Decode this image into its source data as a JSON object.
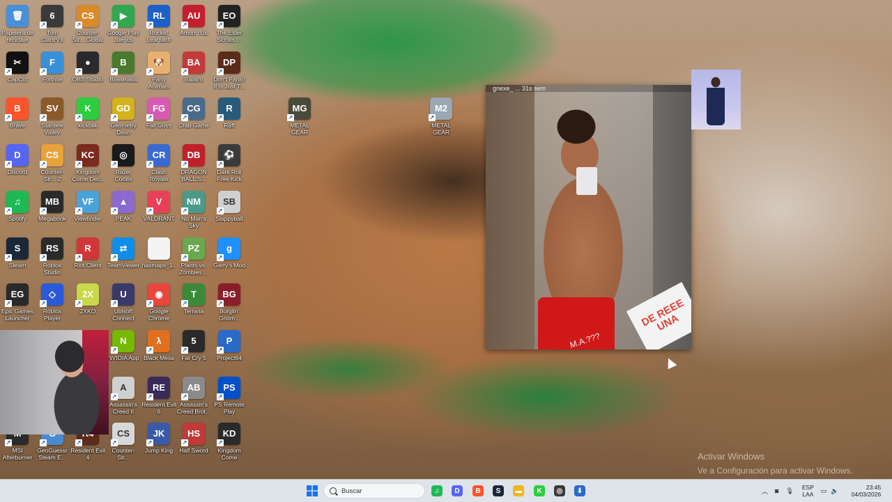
{
  "desktop": {
    "icons": [
      {
        "label": "Papelera de reciclaje",
        "glyph": "🗑",
        "color": "#4a90d9",
        "shortcut": false
      },
      {
        "label": "Tom Clancy's Rainbow Si...",
        "glyph": "6",
        "color": "#3a3a3a",
        "shortcut": true
      },
      {
        "label": "Counter-Str... Global Offe...",
        "glyph": "CS",
        "color": "#d98a2b",
        "shortcut": true
      },
      {
        "label": "Google Play Juegos",
        "glyph": "▶",
        "color": "#2fa84f",
        "shortcut": true
      },
      {
        "label": "Rocket League®",
        "glyph": "RL",
        "color": "#1e5fc8",
        "shortcut": true
      },
      {
        "label": "Among Us",
        "glyph": "AU",
        "color": "#c41f2f",
        "shortcut": true
      },
      {
        "label": "The Elder Scrolls ...",
        "glyph": "EO",
        "color": "#222222",
        "shortcut": true
      },
      {
        "label": "CapCut",
        "glyph": "✂",
        "color": "#111111",
        "shortcut": true
      },
      {
        "label": "Fortnite",
        "glyph": "F",
        "color": "#3a8fd9",
        "shortcut": true
      },
      {
        "label": "OBS Studio",
        "glyph": "●",
        "color": "#2a2a2e",
        "shortcut": true
      },
      {
        "label": "Brawlhalla",
        "glyph": "B",
        "color": "#4a7a2e",
        "shortcut": true
      },
      {
        "label": "Party Animals",
        "glyph": "🐶",
        "color": "#e8b070",
        "shortcut": true
      },
      {
        "label": "Balatro",
        "glyph": "BA",
        "color": "#c23a3a",
        "shortcut": true
      },
      {
        "label": "Don't Panic! It is Just T...",
        "glyph": "DP",
        "color": "#5a2a1a",
        "shortcut": true
      },
      {
        "label": "Brave",
        "glyph": "B",
        "color": "#fb542b",
        "shortcut": true
      },
      {
        "label": "Stardew Valley",
        "glyph": "SV",
        "color": "#8a5a2a",
        "shortcut": true
      },
      {
        "label": "kicktalk",
        "glyph": "K",
        "color": "#2ecc40",
        "shortcut": true
      },
      {
        "label": "Geometry Dash",
        "glyph": "GD",
        "color": "#d4b21c",
        "shortcut": true
      },
      {
        "label": "Fall Guys",
        "glyph": "FG",
        "color": "#d85ab0",
        "shortcut": true
      },
      {
        "label": "Crab Game",
        "glyph": "CG",
        "color": "#4a6a8a",
        "shortcut": true
      },
      {
        "label": "Raft",
        "glyph": "R",
        "color": "#2a5a7a",
        "shortcut": true
      },
      {
        "label": "Discord",
        "glyph": "D",
        "color": "#5865f2",
        "shortcut": true
      },
      {
        "label": "Counter-Str... 2",
        "glyph": "CS",
        "color": "#e8a23a",
        "shortcut": true
      },
      {
        "label": "Kingdom Come Del...",
        "glyph": "KC",
        "color": "#7a2a1e",
        "shortcut": true
      },
      {
        "label": "Razer Cortex",
        "glyph": "◎",
        "color": "#1a1a1a",
        "shortcut": true
      },
      {
        "label": "Clash Royale",
        "glyph": "CR",
        "color": "#3a6ad0",
        "shortcut": true
      },
      {
        "label": "DRAGON BALL S...",
        "glyph": "DB",
        "color": "#c0202a",
        "shortcut": true
      },
      {
        "label": "Dark Roll Free Kick Challe...",
        "glyph": "⚽",
        "color": "#3a3a3a",
        "shortcut": true
      },
      {
        "label": "Spotify",
        "glyph": "♫",
        "color": "#1db954",
        "shortcut": true
      },
      {
        "label": "Megabonk",
        "glyph": "MB",
        "color": "#2a2a2a",
        "shortcut": true
      },
      {
        "label": "Viewfinder",
        "glyph": "VF",
        "color": "#4aa3d6",
        "shortcut": true
      },
      {
        "label": "PEAK",
        "glyph": "▲",
        "color": "#8a6ad0",
        "shortcut": true
      },
      {
        "label": "VALORANT",
        "glyph": "V",
        "color": "#e84057",
        "shortcut": true
      },
      {
        "label": "No Man's Sky",
        "glyph": "NM",
        "color": "#4a9a8a",
        "shortcut": true
      },
      {
        "label": "Slappyball",
        "glyph": "SB",
        "color": "#d0d0d0",
        "shortcut": true
      },
      {
        "label": "Steam",
        "glyph": "S",
        "color": "#1b2838",
        "shortcut": true
      },
      {
        "label": "Roblox Studio",
        "glyph": "RS",
        "color": "#2a2a2a",
        "shortcut": true
      },
      {
        "label": "Riot Client",
        "glyph": "R",
        "color": "#d13639",
        "shortcut": true
      },
      {
        "label": "TeamViewer",
        "glyph": "⇄",
        "color": "#0e8ee9",
        "shortcut": true
      },
      {
        "label": "haxmaps_1...",
        "glyph": "",
        "color": "#f4f4f4",
        "shortcut": false
      },
      {
        "label": "Plants vs. Zombies ...",
        "glyph": "PZ",
        "color": "#6aa84f",
        "shortcut": true
      },
      {
        "label": "Garry's Mod",
        "glyph": "g",
        "color": "#1e90ff",
        "shortcut": true
      },
      {
        "label": "Epic Games Launcher",
        "glyph": "EG",
        "color": "#2a2a2a",
        "shortcut": true
      },
      {
        "label": "Roblox Player",
        "glyph": "◇",
        "color": "#2a5ad8",
        "shortcut": true
      },
      {
        "label": "2XKO",
        "glyph": "2X",
        "color": "#c8d84a",
        "shortcut": true
      },
      {
        "label": "Ubisoft Connect",
        "glyph": "U",
        "color": "#3a3a6a",
        "shortcut": true
      },
      {
        "label": "Google Chrome",
        "glyph": "◉",
        "color": "#e8453c",
        "shortcut": true
      },
      {
        "label": "Terraria",
        "glyph": "T",
        "color": "#3a8a3a",
        "shortcut": true
      },
      {
        "label": "Burglin' Gnom...",
        "glyph": "BG",
        "color": "#8a1e2a",
        "shortcut": true
      },
      {
        "label": "NVIDIA App",
        "glyph": "N",
        "color": "#76b900",
        "shortcut": true
      },
      {
        "label": "Black Mesa",
        "glyph": "λ",
        "color": "#e07020",
        "shortcut": true
      },
      {
        "label": "Far Cry 5",
        "glyph": "5",
        "color": "#2a2a2a",
        "shortcut": true
      },
      {
        "label": "Project64",
        "glyph": "P",
        "color": "#2a6ac8",
        "shortcut": true
      },
      {
        "label": "Assassin's Creed II",
        "glyph": "A",
        "color": "#d0d0d0",
        "shortcut": true
      },
      {
        "label": "Resident Evil 6",
        "glyph": "RE",
        "color": "#3a2a5a",
        "shortcut": true
      },
      {
        "label": "Assassin's Creed Brot...",
        "glyph": "AB",
        "color": "#8a8a8a",
        "shortcut": true
      },
      {
        "label": "PS Remote Play",
        "glyph": "PS",
        "color": "#0050c8",
        "shortcut": true
      },
      {
        "label": "MSI Afterburner",
        "glyph": "M",
        "color": "#2a2a2a",
        "shortcut": true
      },
      {
        "label": "GeoGuessr Steam E...",
        "glyph": "G",
        "color": "#4a8ad0",
        "shortcut": true
      },
      {
        "label": "Resident Evil 4",
        "glyph": "R4",
        "color": "#5a2a1a",
        "shortcut": true
      },
      {
        "label": "Counter-Str...",
        "glyph": "CS",
        "color": "#d8d8d8",
        "shortcut": true
      },
      {
        "label": "Jump King",
        "glyph": "JK",
        "color": "#3a5aa8",
        "shortcut": true
      },
      {
        "label": "Half Sword",
        "glyph": "HS",
        "color": "#c03a3a",
        "shortcut": true
      },
      {
        "label": "Kingdom Come Deliv...",
        "glyph": "KD",
        "color": "#2a2a2a",
        "shortcut": true
      },
      {
        "label": "METAL GEAR SOLID Δ SN...",
        "glyph": "MG",
        "color": "#4a4a3a",
        "shortcut": true
      },
      {
        "label": "METAL GEAR SOLID 2 So...",
        "glyph": "M2",
        "color": "#9aa8b4",
        "shortcut": true
      }
    ]
  },
  "overlays": {
    "story_header": "gnexe_ ... 31s sem",
    "story_sticker": "DE REEE UNA",
    "story_caption": "M.A.???"
  },
  "watermark": {
    "line1": "Activar Windows",
    "line2": "Ve a Configuración para activar Windows."
  },
  "taskbar": {
    "search_placeholder": "Buscar",
    "apps": [
      {
        "name": "spotify-icon",
        "glyph": "♫",
        "color": "#1db954"
      },
      {
        "name": "discord-icon",
        "glyph": "D",
        "color": "#5865f2"
      },
      {
        "name": "brave-icon",
        "glyph": "B",
        "color": "#fb542b"
      },
      {
        "name": "steam-icon",
        "glyph": "S",
        "color": "#1b2838"
      },
      {
        "name": "file-explorer-icon",
        "glyph": "▬",
        "color": "#f2b51b"
      },
      {
        "name": "kicktalk-icon",
        "glyph": "K",
        "color": "#2ecc40"
      },
      {
        "name": "app-circle-icon",
        "glyph": "◎",
        "color": "#3a3a3a"
      },
      {
        "name": "installer-icon",
        "glyph": "⬇",
        "color": "#2a6ac8"
      }
    ],
    "language_top": "ESP",
    "language_bottom": "LAA",
    "time": "23:45",
    "date": "04/03/2026"
  }
}
